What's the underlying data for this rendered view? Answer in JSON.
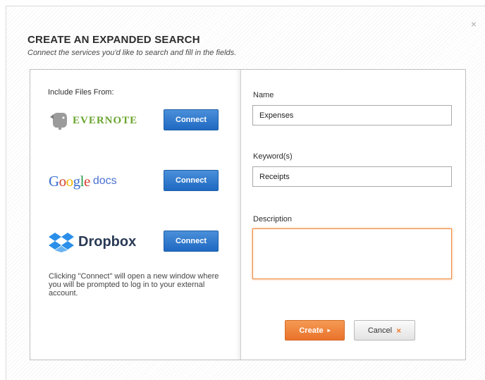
{
  "dialog": {
    "close_icon": "×",
    "title": "CREATE AN EXPANDED SEARCH",
    "subtitle": "Connect the services you'd like to search and fill in the fields."
  },
  "left": {
    "include_label": "Include Files From:",
    "services": [
      {
        "name": "EVERNOTE",
        "button": "Connect",
        "icon": "evernote-elephant-icon",
        "color": "#6aa52e"
      },
      {
        "name_google": "Google",
        "name_docs": "docs",
        "button": "Connect",
        "icon": "google-docs-logo"
      },
      {
        "name": "Dropbox",
        "button": "Connect",
        "icon": "dropbox-box-icon",
        "color": "#2a8fe8"
      }
    ],
    "note": "Clicking \"Connect\" will open a new window where you will be prompted to log in to your external account."
  },
  "form": {
    "name_label": "Name",
    "name_value": "Expenses",
    "keywords_label": "Keyword(s)",
    "keywords_value": "Receipts",
    "description_label": "Description",
    "description_value": "",
    "create_label": "Create",
    "create_icon": "▸",
    "cancel_label": "Cancel",
    "cancel_icon": "×"
  },
  "colors": {
    "connect_blue": "#2a78d0",
    "create_orange": "#ee7f35",
    "focus_orange": "#f08a3e"
  }
}
